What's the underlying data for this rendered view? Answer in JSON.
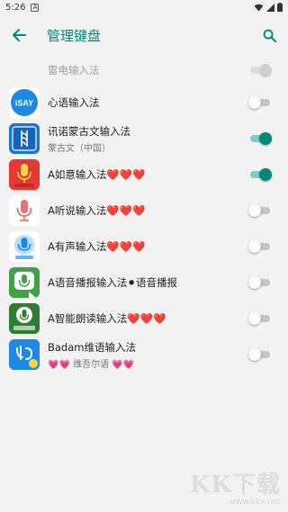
{
  "status_bar": {
    "time": "5:26",
    "notification_glyph": "A",
    "icons": [
      "wifi-icon",
      "signal-icon",
      "battery-icon"
    ]
  },
  "app_bar": {
    "title": "管理键盘",
    "back_icon": "arrow-left-icon",
    "search_icon": "search-icon",
    "accent": "#00897b"
  },
  "keyboards": [
    {
      "name": "雷电输入法",
      "sub": "",
      "enabled": true,
      "locked": true
    },
    {
      "name": "心语输入法",
      "sub": "",
      "enabled": false,
      "icon_text": "iSAY"
    },
    {
      "name": "讯诺蒙古文输入法",
      "sub": "蒙古文（中国）",
      "enabled": true
    },
    {
      "name": "A如意输入法❤️❤️❤️",
      "sub": "",
      "enabled": true
    },
    {
      "name": "A听说输入法❤️❤️❤️",
      "sub": "",
      "enabled": false
    },
    {
      "name": "A有声输入法❤️❤️❤️",
      "sub": "",
      "enabled": false
    },
    {
      "name": "A语音播报输入法⚫语音播报",
      "sub": "",
      "enabled": false
    },
    {
      "name": "A智能朗读输入法❤️❤️❤️",
      "sub": "",
      "enabled": false
    },
    {
      "name": "Badam维语输入法",
      "sub": "💗💗 维吾尔语 💗💗",
      "enabled": false
    }
  ],
  "watermark": {
    "text": "KK下载",
    "url": "www.kkx.net"
  }
}
